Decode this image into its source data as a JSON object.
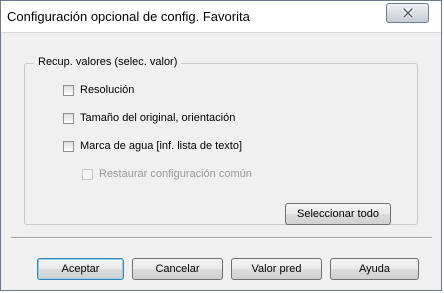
{
  "window": {
    "title": "Configuración opcional de config. Favorita"
  },
  "group": {
    "legend": "Recup. valores (selec. valor)",
    "options": [
      {
        "label": "Resolución",
        "checked": false,
        "enabled": true
      },
      {
        "label": "Tamaño del original, orientación",
        "checked": false,
        "enabled": true
      },
      {
        "label": "Marca de agua [inf. lista de texto]",
        "checked": false,
        "enabled": true
      },
      {
        "label": "Restaurar configuración común",
        "checked": false,
        "enabled": false
      }
    ],
    "select_all_label": "Seleccionar todo"
  },
  "footer": {
    "ok_label": "Aceptar",
    "cancel_label": "Cancelar",
    "default_label": "Valor pred",
    "help_label": "Ayuda"
  },
  "colors": {
    "window_background": "#f0f0f0",
    "title_background": "#ffffff",
    "disabled_text": "#9a9a9a",
    "default_button_border": "#3c7fb1"
  },
  "icons": {
    "close": "close-icon"
  }
}
